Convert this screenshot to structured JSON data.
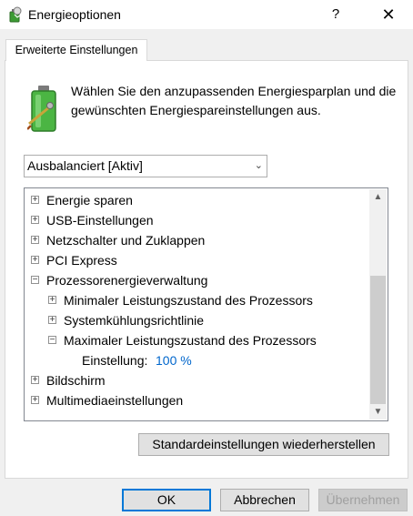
{
  "window": {
    "title": "Energieoptionen",
    "help": "?",
    "close": "✕"
  },
  "tab": {
    "label": "Erweiterte Einstellungen"
  },
  "description": "Wählen Sie den anzupassenden Energiesparplan und die gewünschten Energiespareinstellungen aus.",
  "plan_select": {
    "value": "Ausbalanciert [Aktiv]"
  },
  "tree": {
    "items": [
      {
        "label": "Energie sparen",
        "expander": "+"
      },
      {
        "label": "USB-Einstellungen",
        "expander": "+"
      },
      {
        "label": "Netzschalter und Zuklappen",
        "expander": "+"
      },
      {
        "label": "PCI Express",
        "expander": "+"
      },
      {
        "label": "Prozessorenergieverwaltung",
        "expander": "−"
      },
      {
        "label": "Minimaler Leistungszustand des Prozessors",
        "expander": "+"
      },
      {
        "label": "Systemkühlungsrichtlinie",
        "expander": "+"
      },
      {
        "label": "Maximaler Leistungszustand des Prozessors",
        "expander": "−"
      },
      {
        "label": "Bildschirm",
        "expander": "+"
      },
      {
        "label": "Multimediaeinstellungen",
        "expander": "+"
      }
    ],
    "setting": {
      "label": "Einstellung:",
      "value": "100 %"
    }
  },
  "scrollbar": {
    "up": "▲",
    "down": "▼"
  },
  "buttons": {
    "restore": "Standardeinstellungen wiederherstellen",
    "ok": "OK",
    "cancel": "Abbrechen",
    "apply": "Übernehmen"
  },
  "colors": {
    "link_value": "#0066cc",
    "accent": "#0078d7"
  }
}
